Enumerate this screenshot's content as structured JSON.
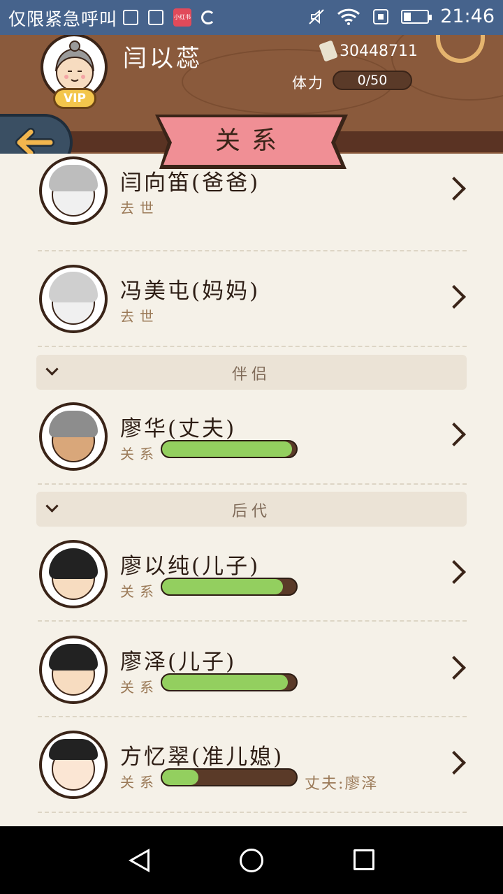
{
  "status_bar": {
    "carrier": "仅限紧急呼叫",
    "app_badge": "小红书",
    "time": "21:46"
  },
  "header": {
    "player_name": "闫以蕊",
    "vip_label": "VIP",
    "coins": "30448711",
    "stamina_label": "体力",
    "stamina_value": "0/50",
    "title": "关系"
  },
  "relations": {
    "dad": {
      "name": "闫向笛(爸爸)",
      "status": "去世"
    },
    "mom": {
      "name": "冯美屯(妈妈)",
      "status": "去世"
    },
    "partner_section": "伴侣",
    "husband": {
      "name": "廖华(丈夫)",
      "rel_label": "关系",
      "level": 0.97
    },
    "descendants_section": "后代",
    "son1": {
      "name": "廖以纯(儿子)",
      "rel_label": "关系",
      "level": 0.9
    },
    "son2": {
      "name": "廖泽(儿子)",
      "rel_label": "关系",
      "level": 0.94
    },
    "fiancee": {
      "name": "方忆翠(准儿媳)",
      "rel_label": "关系",
      "level": 0.27,
      "spouse_label": "丈夫:廖泽"
    }
  },
  "colors": {
    "wood": "#8a5a3c",
    "banner": "#f08f95",
    "bar_fill": "#93cf5f",
    "bg": "#f5f1e8"
  }
}
